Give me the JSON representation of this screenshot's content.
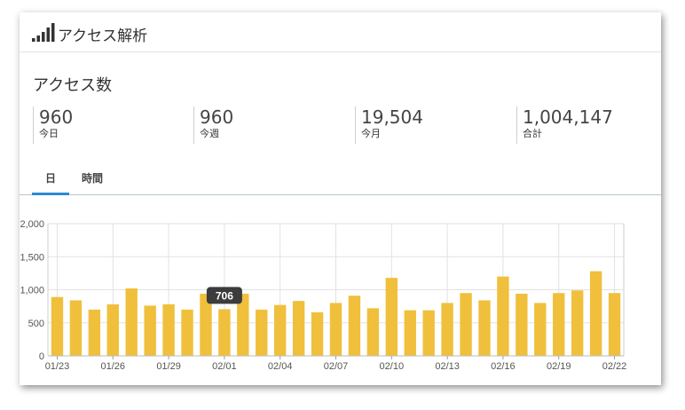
{
  "header": {
    "icon": "signal-bars-icon",
    "title": "アクセス解析"
  },
  "section": {
    "title": "アクセス数"
  },
  "stats": [
    {
      "value": "960",
      "label": "今日"
    },
    {
      "value": "960",
      "label": "今週"
    },
    {
      "value": "19,504",
      "label": "今月"
    },
    {
      "value": "1,004,147",
      "label": "合計"
    }
  ],
  "tabs": [
    {
      "label": "日",
      "active": true
    },
    {
      "label": "時間",
      "active": false
    }
  ],
  "colors": {
    "bar": "#f0c03c",
    "tab_active": "#2a8bd2",
    "tooltip_bg": "#3c3c3c"
  },
  "chart_data": {
    "type": "bar",
    "grid": true,
    "ylim": [
      0,
      2000
    ],
    "yticks": [
      "0",
      "500",
      "1,000",
      "1,500",
      "2,000"
    ],
    "ytick_values": [
      0,
      500,
      1000,
      1500,
      2000
    ],
    "xtick_labels": [
      "01/23",
      "01/26",
      "01/29",
      "02/01",
      "02/04",
      "02/07",
      "02/10",
      "02/13",
      "02/16",
      "02/19",
      "02/22"
    ],
    "categories": [
      "01/23",
      "01/24",
      "01/25",
      "01/26",
      "01/27",
      "01/28",
      "01/29",
      "01/30",
      "01/31",
      "02/01",
      "02/02",
      "02/03",
      "02/04",
      "02/05",
      "02/06",
      "02/07",
      "02/08",
      "02/09",
      "02/10",
      "02/11",
      "02/12",
      "02/13",
      "02/14",
      "02/15",
      "02/16",
      "02/17",
      "02/18",
      "02/19",
      "02/20",
      "02/21",
      "02/22"
    ],
    "values": [
      890,
      840,
      700,
      780,
      1020,
      760,
      780,
      700,
      940,
      706,
      940,
      700,
      770,
      830,
      660,
      800,
      910,
      720,
      1180,
      690,
      690,
      800,
      950,
      840,
      1200,
      940,
      800,
      950,
      990,
      1280,
      950
    ],
    "tooltip": {
      "category": "02/01",
      "text": "706"
    }
  }
}
